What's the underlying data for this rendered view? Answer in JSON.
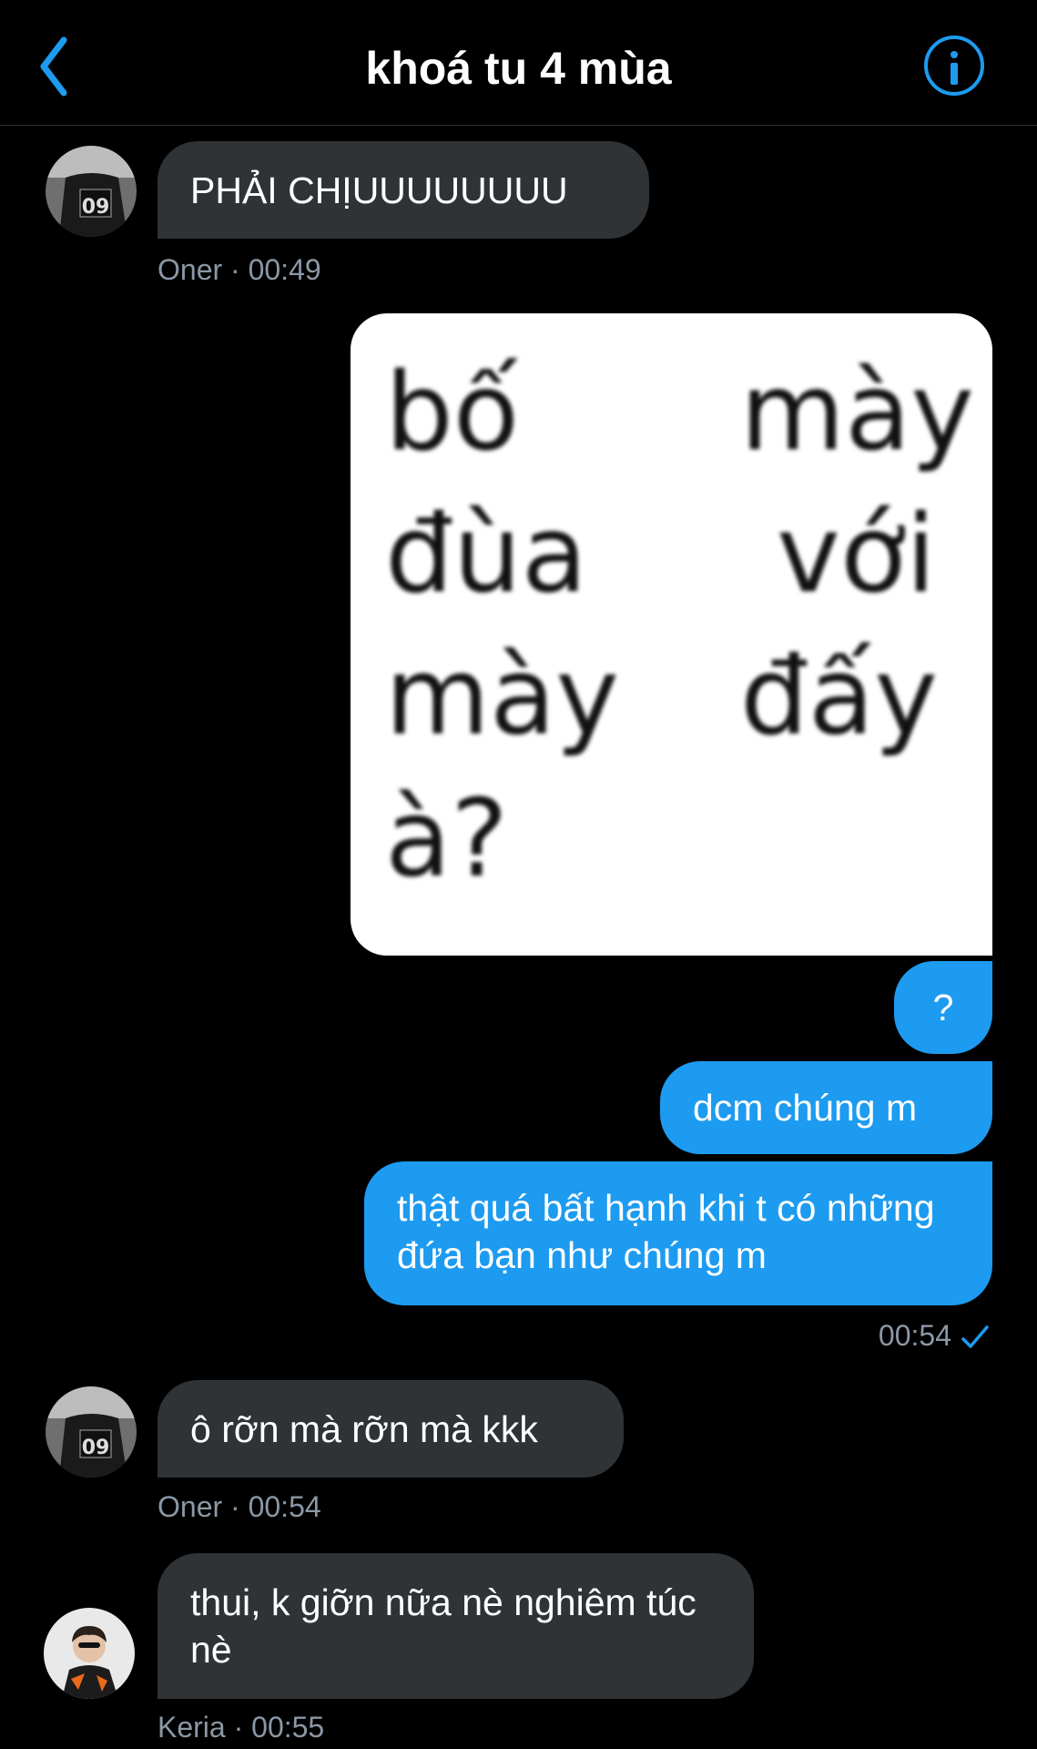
{
  "header": {
    "title": "khoá tu 4 mùa"
  },
  "messages": [
    {
      "text": "PHẢI CHỊUUUUUUUU",
      "meta": "Oner · 00:49"
    },
    {
      "image_words": [
        "bố",
        "mày",
        "đùa",
        "với",
        "mày",
        "đấy",
        "à?"
      ]
    },
    {
      "text": "?"
    },
    {
      "text": "dcm chúng m"
    },
    {
      "text": "thật quá bất hạnh khi t có những đứa bạn như chúng m",
      "meta": "00:54"
    },
    {
      "text": "ô rỡn mà rỡn mà kkk",
      "meta": "Oner · 00:54"
    },
    {
      "text": "thui, k giỡn nữa nè nghiêm túc nè",
      "meta": "Keria · 00:55"
    }
  ],
  "colors": {
    "accent": "#1d9bf0",
    "incoming_bubble": "#2f3336",
    "meta_text": "#8b98a5"
  },
  "icons": {
    "back": "chevron-left-icon",
    "info": "info-circle-icon",
    "read": "checkmark-icon"
  }
}
